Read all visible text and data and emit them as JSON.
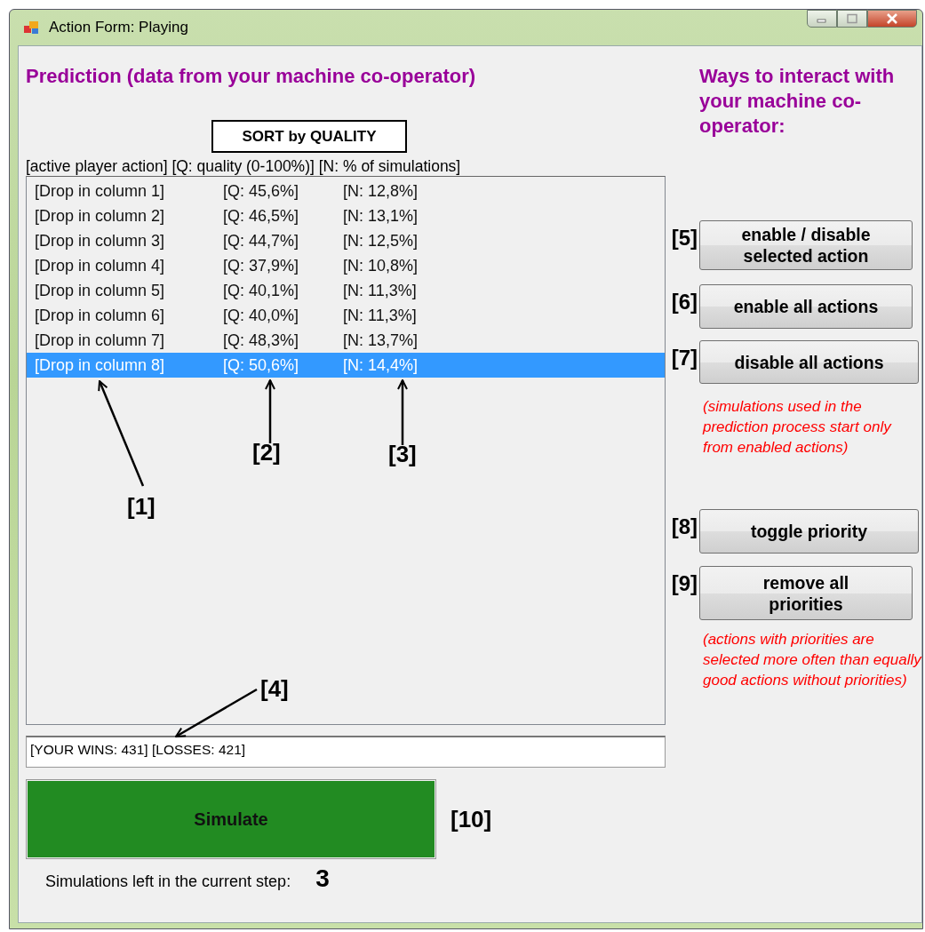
{
  "window": {
    "title": "Action Form: Playing"
  },
  "prediction": {
    "heading": "Prediction (data from your machine co-operator)",
    "sort_button": "SORT by QUALITY",
    "column_header": "[active player action] [Q: quality (0-100%)] [N: % of simulations]",
    "rows": [
      {
        "action": "[Drop in column 1]",
        "quality": "[Q: 45,6%]",
        "share": "[N: 12,8%]",
        "selected": false
      },
      {
        "action": "[Drop in column 2]",
        "quality": "[Q: 46,5%]",
        "share": "[N: 13,1%]",
        "selected": false
      },
      {
        "action": "[Drop in column 3]",
        "quality": "[Q: 44,7%]",
        "share": "[N: 12,5%]",
        "selected": false
      },
      {
        "action": "[Drop in column 4]",
        "quality": "[Q: 37,9%]",
        "share": "[N: 10,8%]",
        "selected": false
      },
      {
        "action": "[Drop in column 5]",
        "quality": "[Q: 40,1%]",
        "share": "[N: 11,3%]",
        "selected": false
      },
      {
        "action": "[Drop in column 6]",
        "quality": "[Q: 40,0%]",
        "share": "[N: 11,3%]",
        "selected": false
      },
      {
        "action": "[Drop in column 7]",
        "quality": "[Q: 48,3%]",
        "share": "[N: 13,7%]",
        "selected": false
      },
      {
        "action": "[Drop in column 8]",
        "quality": "[Q: 50,6%]",
        "share": "[N: 14,4%]",
        "selected": true
      }
    ],
    "callouts": [
      "[1]",
      "[2]",
      "[3]",
      "[4]"
    ],
    "score": "[YOUR WINS: 431] [LOSSES: 421]",
    "simulate": {
      "label": "Simulate",
      "marker": "[10]"
    },
    "remaining": {
      "label": "Simulations left in the current step:",
      "value": "3"
    }
  },
  "interaction": {
    "heading": "Ways to interact with your machine co-operator:",
    "items": [
      {
        "kind": "button",
        "marker": "[5]",
        "label": "enable / disable selected action"
      },
      {
        "kind": "button",
        "marker": "[6]",
        "label": "enable all actions"
      },
      {
        "kind": "button",
        "marker": "[7]",
        "label": "disable all actions"
      },
      {
        "kind": "note",
        "label": "(simulations used in the prediction process start only from enabled actions)"
      },
      {
        "kind": "button",
        "marker": "[8]",
        "label": "toggle priority"
      },
      {
        "kind": "button",
        "marker": "[9]",
        "label": "remove all priorities"
      },
      {
        "kind": "note",
        "label": "(actions with priorities are selected more often than equally good actions without priorities)"
      }
    ]
  }
}
